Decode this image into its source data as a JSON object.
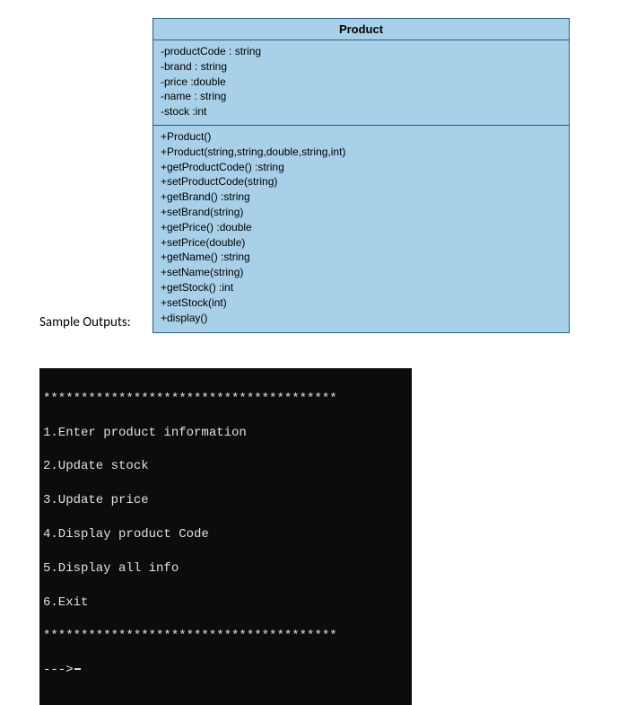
{
  "uml": {
    "title": "Product",
    "attributes": [
      "-productCode : string",
      "-brand : string",
      "-price :double",
      "-name : string",
      "-stock :int"
    ],
    "methods": [
      "+Product()",
      "+Product(string,string,double,string,int)",
      "+getProductCode() :string",
      "+setProductCode(string)",
      "+getBrand() :string",
      "+setBrand(string)",
      "+getPrice() :double",
      "+setPrice(double)",
      "+getName() :string",
      "+setName(string)",
      "+getStock() :int",
      "+setStock(int)",
      "+display()"
    ]
  },
  "sample_label": "Sample Outputs:",
  "terminal": {
    "divider": "***************************************",
    "menu": [
      "1.Enter product information",
      "2.Update stock",
      "3.Update price",
      "4.Display product Code",
      "5.Display all info",
      "6.Exit"
    ],
    "prompt": "--->"
  }
}
